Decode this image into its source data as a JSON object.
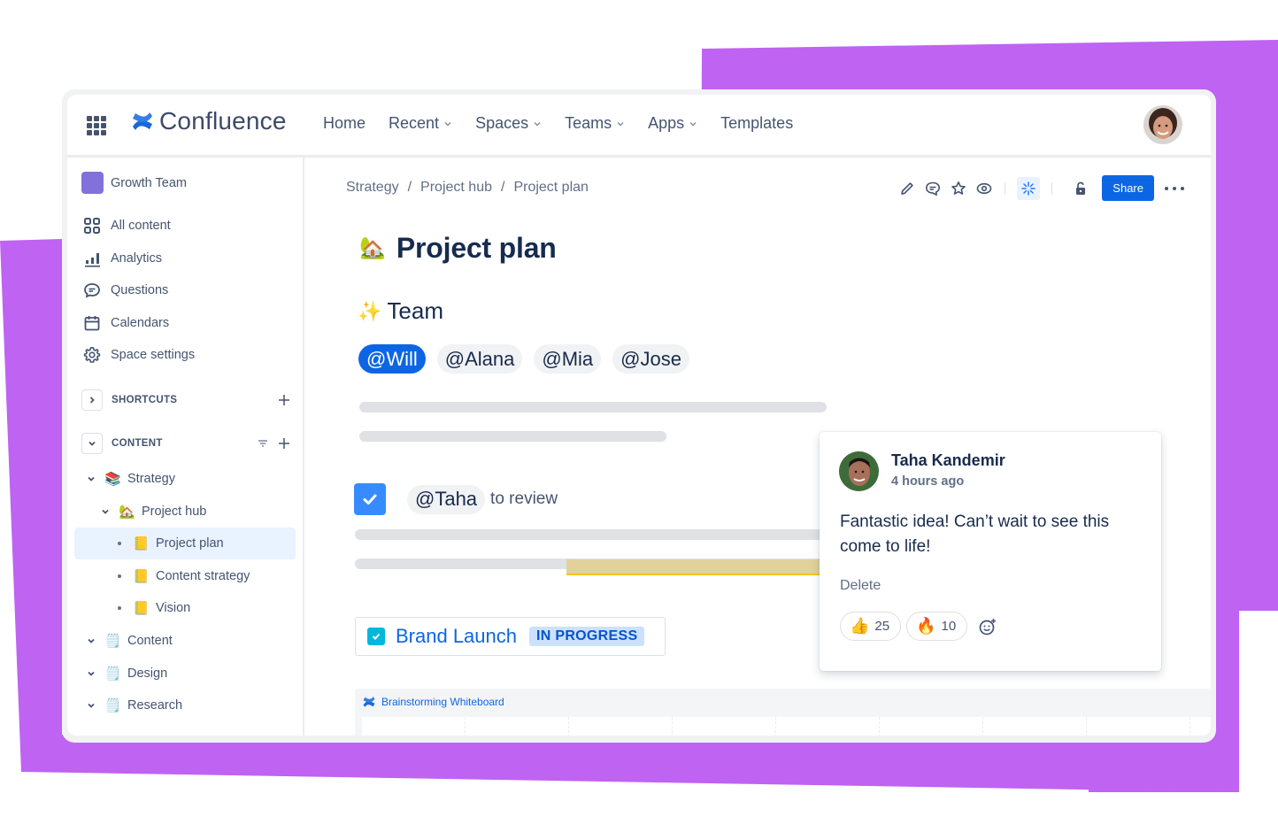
{
  "colors": {
    "accent_purple": "#bf63f3",
    "brand_blue": "#0c66e4",
    "space_icon": "#8270db",
    "highlight": "#e0d29a"
  },
  "topnav": {
    "apps_icon": "app-switcher-icon",
    "product_name": "Confluence",
    "items": [
      {
        "label": "Home",
        "has_dropdown": false
      },
      {
        "label": "Recent",
        "has_dropdown": true
      },
      {
        "label": "Spaces",
        "has_dropdown": true
      },
      {
        "label": "Teams",
        "has_dropdown": true
      },
      {
        "label": "Apps",
        "has_dropdown": true
      },
      {
        "label": "Templates",
        "has_dropdown": false
      }
    ],
    "profile_avatar": "user-avatar"
  },
  "sidebar": {
    "space_name": "Growth Team",
    "items": [
      {
        "label": "All content",
        "icon": "grid-icon"
      },
      {
        "label": "Analytics",
        "icon": "bar-chart-icon"
      },
      {
        "label": "Questions",
        "icon": "speech-bubble-icon"
      },
      {
        "label": "Calendars",
        "icon": "calendar-icon"
      },
      {
        "label": "Space settings",
        "icon": "gear-icon"
      }
    ],
    "shortcuts_title": "SHORTCUTS",
    "content_title": "CONTENT",
    "tree": [
      {
        "label": "Strategy",
        "emoji": "📚",
        "level": 0,
        "marker": "chevron",
        "selected": false
      },
      {
        "label": "Project hub",
        "emoji": "🏡",
        "level": 1,
        "marker": "chevron",
        "selected": false
      },
      {
        "label": "Project plan",
        "emoji": "📒",
        "level": 2,
        "marker": "dot",
        "selected": true
      },
      {
        "label": "Content strategy",
        "emoji": "📒",
        "level": 2,
        "marker": "dot",
        "selected": false
      },
      {
        "label": "Vision",
        "emoji": "📒",
        "level": 2,
        "marker": "dot",
        "selected": false
      },
      {
        "label": "Content",
        "emoji": "🗒️",
        "level": 0,
        "marker": "chevron",
        "selected": false
      },
      {
        "label": "Design",
        "emoji": "🗒️",
        "level": 0,
        "marker": "chevron",
        "selected": false
      },
      {
        "label": "Research",
        "emoji": "🗒️",
        "level": 0,
        "marker": "chevron",
        "selected": false
      }
    ]
  },
  "main": {
    "breadcrumb": [
      "Strategy",
      "Project hub",
      "Project plan"
    ],
    "toolbar": {
      "icons": [
        "edit-icon",
        "comment-icon",
        "star-icon",
        "watch-icon",
        "ai-sparkle-icon",
        "unlock-icon"
      ],
      "share_label": "Share",
      "more_icon": "more-icon"
    },
    "title_emoji": "🏡",
    "title": "Project plan",
    "team_heading_emoji": "✨",
    "team_heading": "Team",
    "mentions": [
      "@Will",
      "@Alana",
      "@Mia",
      "@Jose"
    ],
    "task": {
      "checked": true,
      "mention": "@Taha",
      "text": "to review"
    },
    "jira": {
      "title": "Brand Launch",
      "status": "IN PROGRESS"
    },
    "whiteboard": {
      "title": "Brainstorming Whiteboard"
    }
  },
  "comment": {
    "author": "Taha Kandemir",
    "time": "4 hours ago",
    "body": "Fantastic idea! Can’t wait to see this come to life!",
    "delete_label": "Delete",
    "reactions": [
      {
        "emoji": "👍",
        "count": "25"
      },
      {
        "emoji": "🔥",
        "count": "10"
      }
    ],
    "add_reaction_icon": "add-reaction-icon"
  }
}
